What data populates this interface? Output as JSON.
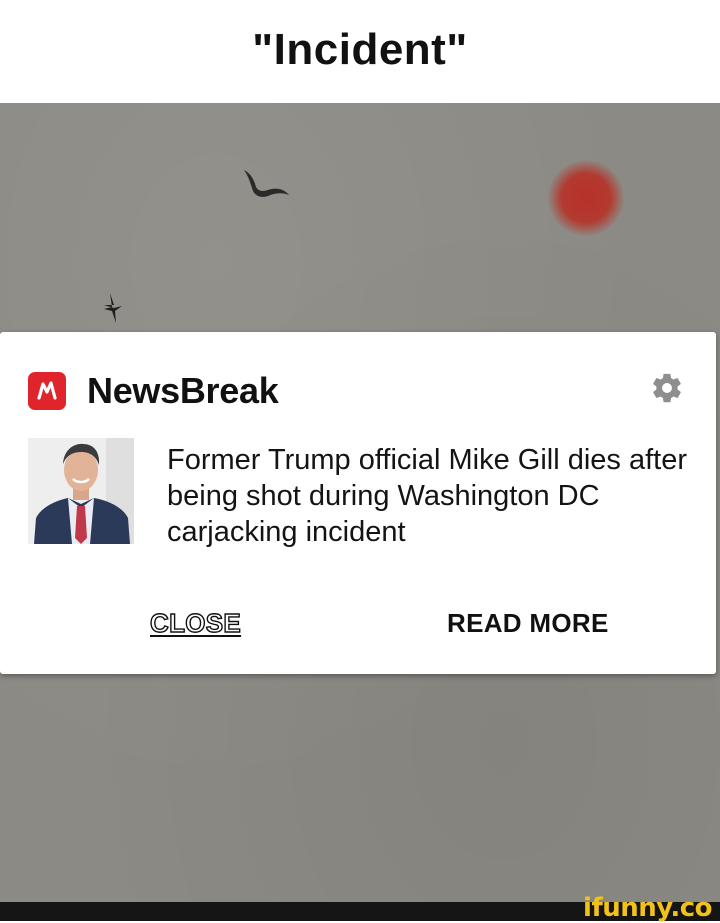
{
  "caption": {
    "text": "\"Incident\""
  },
  "notification": {
    "app_name": "NewsBreak",
    "app_icon": "newsbreak-logo-icon",
    "settings_icon": "gear-icon",
    "headline": "Former Trump official Mike Gill dies after being shot during Washington DC carjacking incident",
    "thumbnail": "portrait-photo",
    "buttons": {
      "close": "CLOSE",
      "read_more": "READ MORE"
    }
  },
  "watermark": {
    "text": "ifunny.co"
  },
  "colors": {
    "brand_red": "#e0242b",
    "background_gray": "#8c8a84",
    "sun_red": "#b8302a",
    "watermark_yellow": "#f2c21a"
  }
}
